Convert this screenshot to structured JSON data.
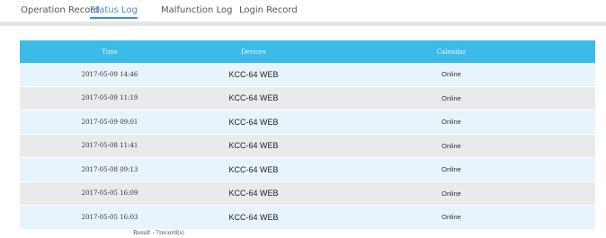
{
  "tabs": [
    {
      "label": "Operation Record",
      "active": false
    },
    {
      "label": "Status Log",
      "active": true
    },
    {
      "label": "Malfunction Log",
      "active": false
    },
    {
      "label": "Login Record",
      "active": false
    }
  ],
  "table": {
    "headers": {
      "time": "Time",
      "devices": "Devices",
      "calendar": "Calendar"
    },
    "rows": [
      {
        "time": "2017-05-09 14:46",
        "device": "KCC-64 WEB",
        "status": "Online"
      },
      {
        "time": "2017-05-09 11:19",
        "device": "KCC-64 WEB",
        "status": "Online"
      },
      {
        "time": "2017-05-09 09:01",
        "device": "KCC-64 WEB",
        "status": "Online"
      },
      {
        "time": "2017-05-08 11:41",
        "device": "KCC-64 WEB",
        "status": "Online"
      },
      {
        "time": "2017-05-08 09:13",
        "device": "KCC-64 WEB",
        "status": "Online"
      },
      {
        "time": "2017-05-05 16:09",
        "device": "KCC-64 WEB",
        "status": "Online"
      },
      {
        "time": "2017-05-05 16:03",
        "device": "KCC-64 WEB",
        "status": "Online"
      }
    ]
  },
  "footer": {
    "result_text": "Result : 7record(s)"
  },
  "colors": {
    "header_bg": "#3cbbe9",
    "active_tab": "#3a8fd6",
    "row_light": "#e8f4fb",
    "row_gray": "#eaeaea"
  }
}
